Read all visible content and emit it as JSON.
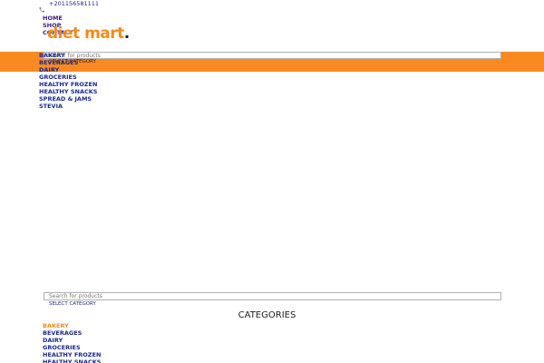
{
  "header": {
    "phone": "+201156581111",
    "phone_icon": "phone-icon",
    "nav": [
      "HOME",
      "SHOP",
      "CONTACT"
    ],
    "logo": {
      "text": "diet mart",
      "dot": "."
    }
  },
  "search": {
    "placeholder": "Search for products",
    "category_select": "SELECT CATEGORY"
  },
  "categories_heading": "CATEGORIES",
  "categories": [
    "BAKERY",
    "BEVERAGES",
    "DAIRY",
    "GROCERIES",
    "HEALTHY FROZEN",
    "HEALTHY SNACKS",
    "SPREAD & JAMS",
    "STEVIA"
  ],
  "colors": {
    "brand_orange": "#fa8a20",
    "link_navy": "#1a2a8c",
    "active_orange": "#f28a1e"
  }
}
